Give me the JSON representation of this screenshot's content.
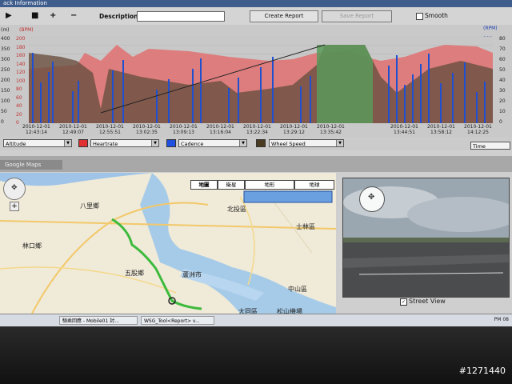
{
  "window": {
    "title": "ack Information"
  },
  "toolbar": {
    "play_icon": "play-icon",
    "description_label": "Description:",
    "description_value": "",
    "create_report": "Create Report",
    "save_report": "Save Report",
    "smooth_label": "Smooth"
  },
  "chart_data": {
    "type": "area",
    "left_axis_unit": "(m)",
    "left_axis_unit2": "(BPM)",
    "right_axis_unit": "(RPM)",
    "left_ticks": [
      "200",
      "180",
      "160",
      "140",
      "120",
      "100",
      "80",
      "60",
      "40",
      "20",
      "0"
    ],
    "left_ticks_outer": [
      "400",
      "350",
      "300",
      "250",
      "200",
      "150",
      "100",
      "50",
      "0"
    ],
    "right_ticks": [
      "120",
      "100",
      "80",
      "60",
      "40",
      "20",
      "0"
    ],
    "right_ticks_outer": [
      "80",
      "70",
      "60",
      "50",
      "40",
      "30",
      "20",
      "10",
      "0"
    ],
    "x_date_labels": [
      "2010-12-01",
      "2010-12-01",
      "2010-12-01",
      "2010-12-01",
      "2010-12-01",
      "2010-12-01",
      "2010-12-01",
      "2010-12-01",
      "2010-12-01",
      "2010-12-01",
      "2010-12-01",
      "2010-12-01",
      "2010-12-01"
    ],
    "x_time_labels": [
      "12:43:14",
      "12:49:07",
      "12:55:51",
      "13:02:35",
      "13:09:13",
      "13:16:04",
      "13:22:34",
      "13:29:12",
      "13:35:42",
      "",
      "13:44:51",
      "13:58:12",
      "14:12:25"
    ],
    "ylim_bpm": [
      0,
      200
    ],
    "ylim_rpm": [
      0,
      120
    ],
    "series": [
      {
        "name": "Altitude",
        "color": "#5a6b3a"
      },
      {
        "name": "Heartrate",
        "color": "#e05050"
      },
      {
        "name": "Cadence",
        "color": "#2050d0"
      },
      {
        "name": "Wheel Speed",
        "color": "#4a3a20"
      }
    ]
  },
  "series_row": {
    "altitude": "Altitude",
    "heartrate": "Heartrate",
    "cadence": "Cadence",
    "wheel_speed": "Wheel Speed",
    "x_axis": "Time"
  },
  "map": {
    "tab": "Google Maps",
    "types": [
      "地圖",
      "衛星",
      "地形",
      "地球"
    ],
    "labels": [
      "北投區",
      "士林區",
      "八里鄉",
      "林口鄉",
      "五股鄉",
      "蘆洲市",
      "中山區",
      "大同區",
      "松山機場",
      "泰山鄉",
      "淡水",
      "關渡",
      "天母",
      "內湖"
    ]
  },
  "street_view": {
    "label": "Street View"
  },
  "taskbar": {
    "items": [
      "",
      "騎乘回應 - Mobile01 討...",
      "WSG_Tool<Report> v..."
    ],
    "clock": "PM 08"
  },
  "watermark": "#1271440"
}
